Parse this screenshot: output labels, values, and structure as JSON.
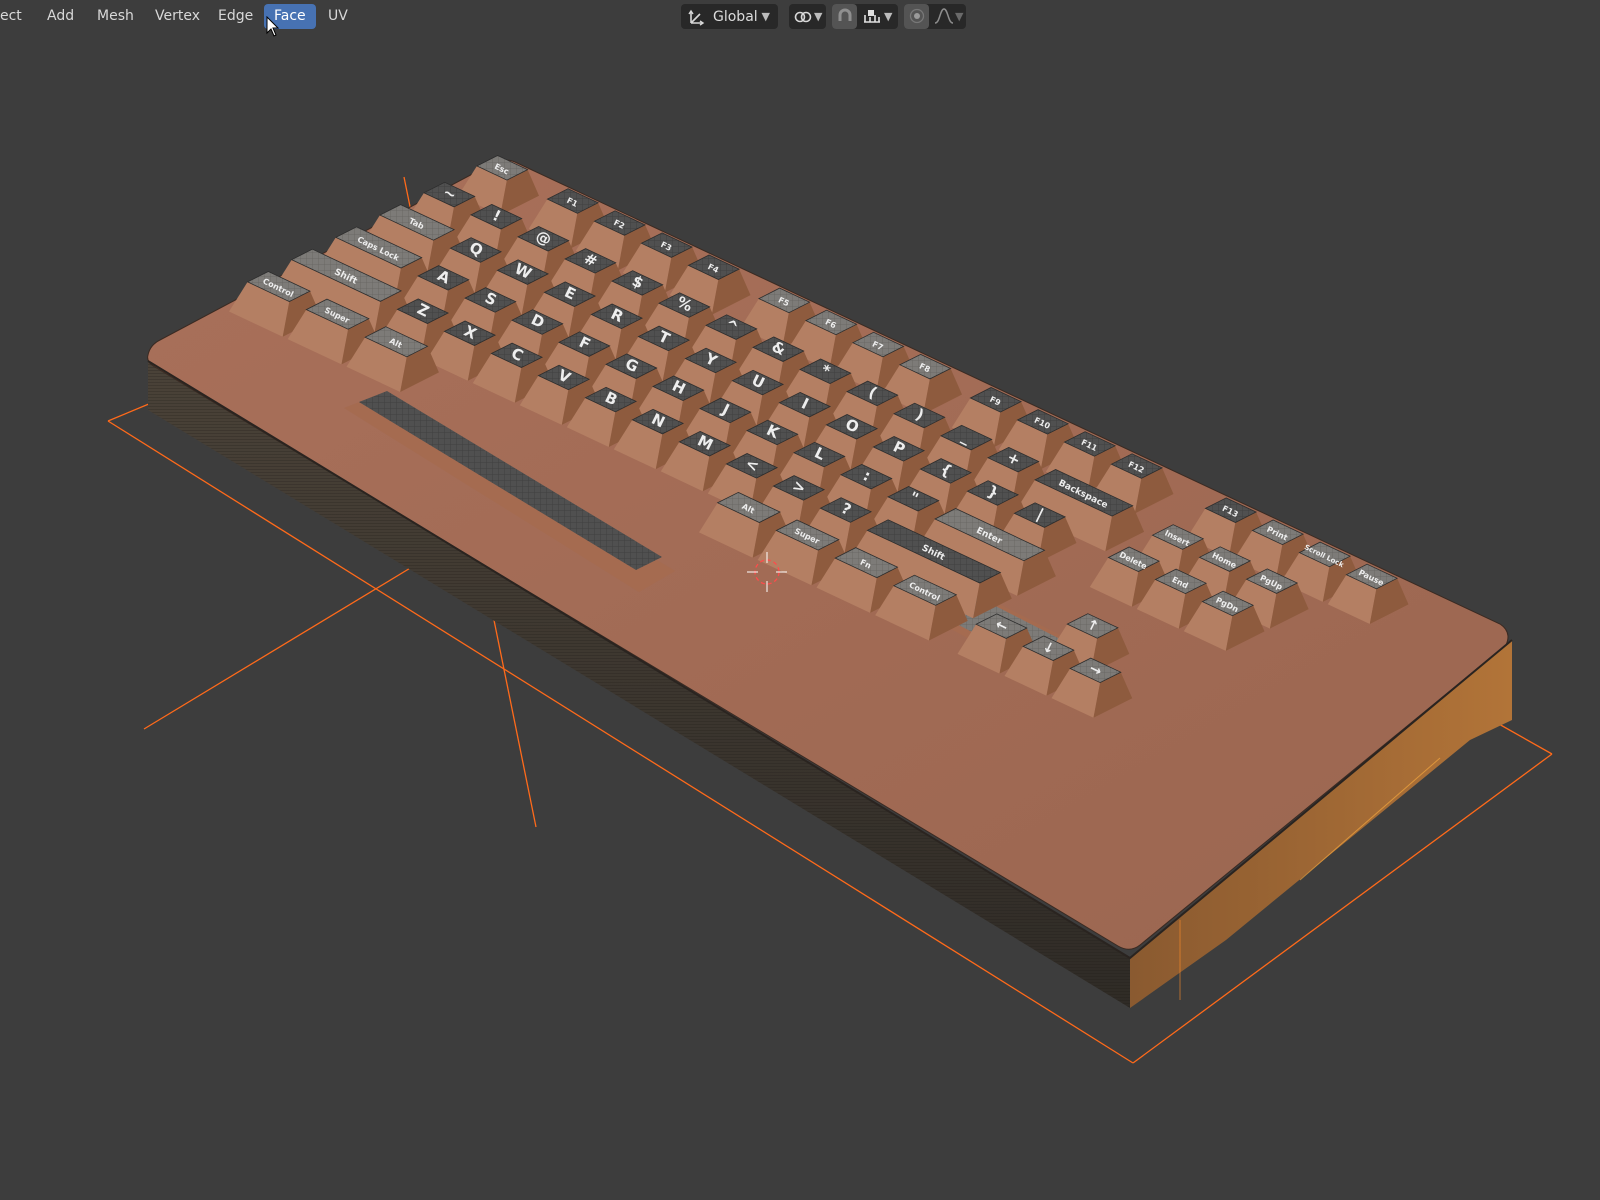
{
  "menu": {
    "object_fragment": "ect",
    "add": "Add",
    "mesh": "Mesh",
    "vertex": "Vertex",
    "edge": "Edge",
    "face": "Face",
    "uv": "UV"
  },
  "header": {
    "orientation_value": "Global"
  },
  "icons": {
    "orientation": "transform-orientation-icon",
    "pivot": "pivot-point-icon",
    "snap": "snap-magnet-icon",
    "snap_target": "snap-increment-icon",
    "proportional": "proportional-editing-icon",
    "falloff": "falloff-curve-icon",
    "cursor": "mouse-pointer-icon",
    "origin": "3d-cursor-icon"
  },
  "colors": {
    "accent": "#4772b3",
    "selection": "#ff6a1a",
    "case": "#a0664a",
    "keycap_side": "#b07a5d",
    "keycap_top": "#4e4e4e"
  },
  "keys": {
    "row_num": [
      "~",
      "!",
      "@",
      "#",
      "$",
      "%",
      "^",
      "&",
      "*",
      "(",
      ")",
      "_",
      "+"
    ],
    "row_q": [
      "Q",
      "W",
      "E",
      "R",
      "T",
      "Y",
      "U",
      "I",
      "O",
      "P",
      "{",
      "}",
      "|"
    ],
    "row_a": [
      "A",
      "S",
      "D",
      "F",
      "G",
      "H",
      "J",
      "K",
      "L",
      ":",
      "\""
    ],
    "row_z": [
      "Z",
      "X",
      "C",
      "V",
      "B",
      "N",
      "M",
      "<",
      ">",
      "?"
    ],
    "fn_row": [
      "F1",
      "F2",
      "F3",
      "F4",
      "F5",
      "F6",
      "F7",
      "F8",
      "F9",
      "F10",
      "F11",
      "F12"
    ],
    "mods_left": [
      "Esc",
      "Tab",
      "Caps Lock",
      "Shift",
      "Control",
      "Super",
      "Alt"
    ],
    "mods_right": [
      "Alt",
      "Super",
      "Fn",
      "Control",
      "Shift",
      "Enter",
      "Backspace"
    ],
    "nav_cluster": [
      "F13",
      "Print",
      "Scroll Lock",
      "Pause",
      "Insert",
      "Home",
      "PgUp",
      "Delete",
      "End",
      "PgDn"
    ],
    "arrows": [
      "←",
      "↓",
      "↑",
      "→"
    ]
  }
}
